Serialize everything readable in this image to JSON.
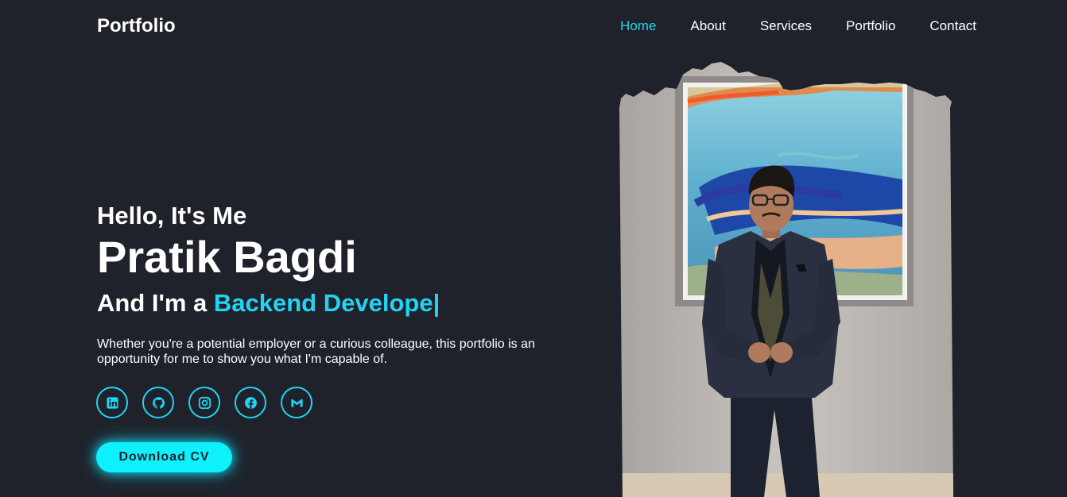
{
  "header": {
    "logo": "Portfolio",
    "nav": [
      {
        "label": "Home",
        "active": true
      },
      {
        "label": "About",
        "active": false
      },
      {
        "label": "Services",
        "active": false
      },
      {
        "label": "Portfolio",
        "active": false
      },
      {
        "label": "Contact",
        "active": false
      }
    ]
  },
  "hero": {
    "greeting": "Hello, It's Me",
    "name": "Pratik Bagdi",
    "role_prefix": "And I'm a ",
    "role_typed": "Backend Develope",
    "cursor": "|",
    "description": "Whether you're a potential employer or a curious colleague, this portfolio is an opportunity for me to show you what I'm capable of."
  },
  "social": [
    {
      "icon": "linkedin-icon"
    },
    {
      "icon": "github-icon"
    },
    {
      "icon": "instagram-icon"
    },
    {
      "icon": "facebook-icon"
    },
    {
      "icon": "gmail-icon"
    }
  ],
  "cv_button": "Download CV",
  "colors": {
    "background": "#1f222b",
    "accent": "#21d4f2",
    "button": "#0ef0fb",
    "text": "#ffffff"
  }
}
